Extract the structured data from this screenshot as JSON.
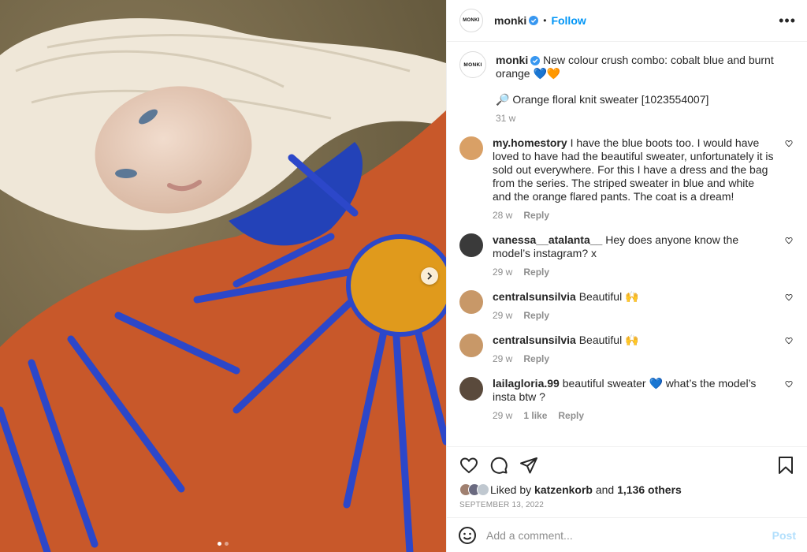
{
  "post": {
    "account": "monki",
    "logo_text": "MONKI",
    "follow_label": "Follow",
    "more_label": "•••",
    "caption": "New colour crush combo: cobalt blue and burnt orange 💙🧡",
    "caption_extra": "🔎 Orange floral knit sweater [1023554007]",
    "caption_time": "31 w",
    "image_alt": "Woman with platinum hair lying on sand wearing an orange and cobalt blue floral knit sweater",
    "carousel": {
      "active_index": 0,
      "count": 2
    }
  },
  "comments": [
    {
      "user": "my.homestory",
      "text": "I have the blue boots too. I would have loved to have had the beautiful sweater, unfortunately it is sold out everywhere. For this I have a dress and the bag from the series. The striped sweater in blue and white and the orange flared pants. The coat is a dream!",
      "time": "28 w",
      "likes": "",
      "reply": "Reply",
      "avatar_color": "#d9a066"
    },
    {
      "user": "vanessa__atalanta__",
      "text": "Hey does anyone know the model’s instagram? x",
      "time": "29 w",
      "likes": "",
      "reply": "Reply",
      "avatar_color": "#3a3a3a"
    },
    {
      "user": "centralsunsilvia",
      "text": "Beautiful 🙌",
      "time": "29 w",
      "likes": "",
      "reply": "Reply",
      "avatar_color": "#c89868"
    },
    {
      "user": "centralsunsilvia",
      "text": "Beautiful 🙌",
      "time": "29 w",
      "likes": "",
      "reply": "Reply",
      "avatar_color": "#c89868"
    },
    {
      "user": "lailagloria.99",
      "text": "beautiful sweater 💙 what’s the model’s insta btw ?",
      "time": "29 w",
      "likes": "1 like",
      "reply": "Reply",
      "avatar_color": "#5a4a3c"
    }
  ],
  "likes": {
    "prefix": "Liked by",
    "user": "katzenkorb",
    "and": "and",
    "others": "1,136 others"
  },
  "date": "SEPTEMBER 13, 2022",
  "add_comment": {
    "placeholder": "Add a comment...",
    "post_label": "Post"
  },
  "colors": {
    "accent": "#0095f6",
    "verified": "#3897f0",
    "post_disabled": "#b2dffc"
  }
}
